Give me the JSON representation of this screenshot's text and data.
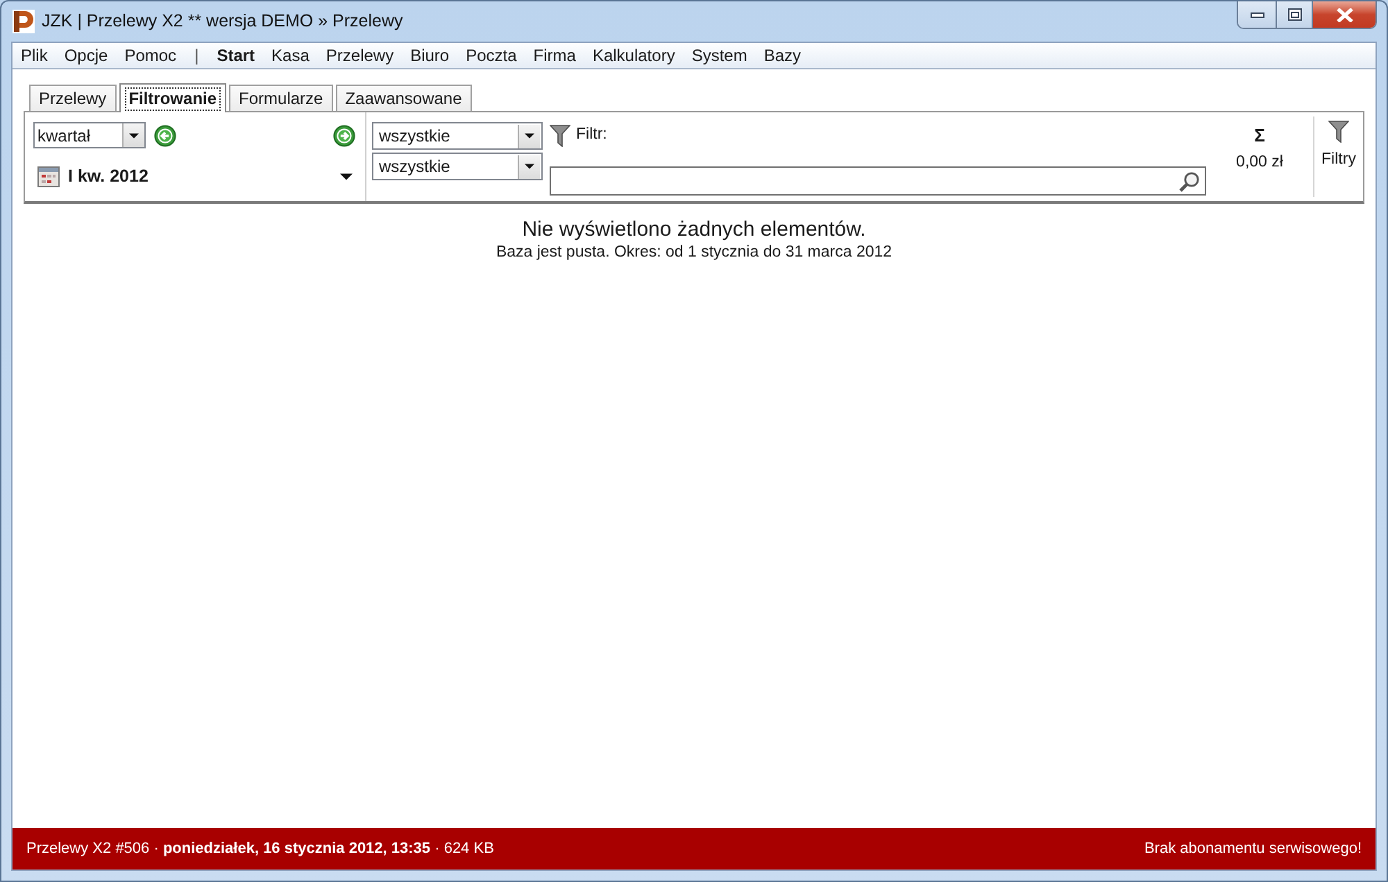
{
  "window": {
    "title": "JZK | Przelewy X2 ** wersja DEMO » Przelewy"
  },
  "menu": {
    "main": [
      "Plik",
      "Opcje",
      "Pomoc"
    ],
    "separator": "|",
    "modules": [
      {
        "label": "Start",
        "bold": true
      },
      {
        "label": "Kasa",
        "bold": false
      },
      {
        "label": "Przelewy",
        "bold": false
      },
      {
        "label": "Biuro",
        "bold": false
      },
      {
        "label": "Poczta",
        "bold": false
      },
      {
        "label": "Firma",
        "bold": false
      },
      {
        "label": "Kalkulatory",
        "bold": false
      },
      {
        "label": "System",
        "bold": false
      },
      {
        "label": "Bazy",
        "bold": false
      }
    ]
  },
  "tabs": [
    {
      "label": "Przelewy",
      "selected": false
    },
    {
      "label": "Filtrowanie",
      "selected": true
    },
    {
      "label": "Formularze",
      "selected": false
    },
    {
      "label": "Zaawansowane",
      "selected": false
    }
  ],
  "filter_panel": {
    "period_type": {
      "value": "kwartał"
    },
    "period": {
      "value": "I kw. 2012"
    },
    "selects": [
      {
        "value": "wszystkie"
      },
      {
        "value": "wszystkie"
      }
    ],
    "filter": {
      "label": "Filtr:"
    },
    "sum": {
      "symbol": "Σ",
      "value": "0,00 zł"
    },
    "filters_button": {
      "label": "Filtry"
    }
  },
  "empty_message": {
    "title": "Nie wyświetlono żadnych elementów.",
    "detail": "Baza jest pusta. Okres: od 1 stycznia do 31 marca 2012"
  },
  "status_bar": {
    "text": "Przelewy X2 #506 · **poniedziałek, 16 stycznia 2012, 13:35** · 624 KB",
    "notice": "Brak abonamentu serwisowego!"
  }
}
